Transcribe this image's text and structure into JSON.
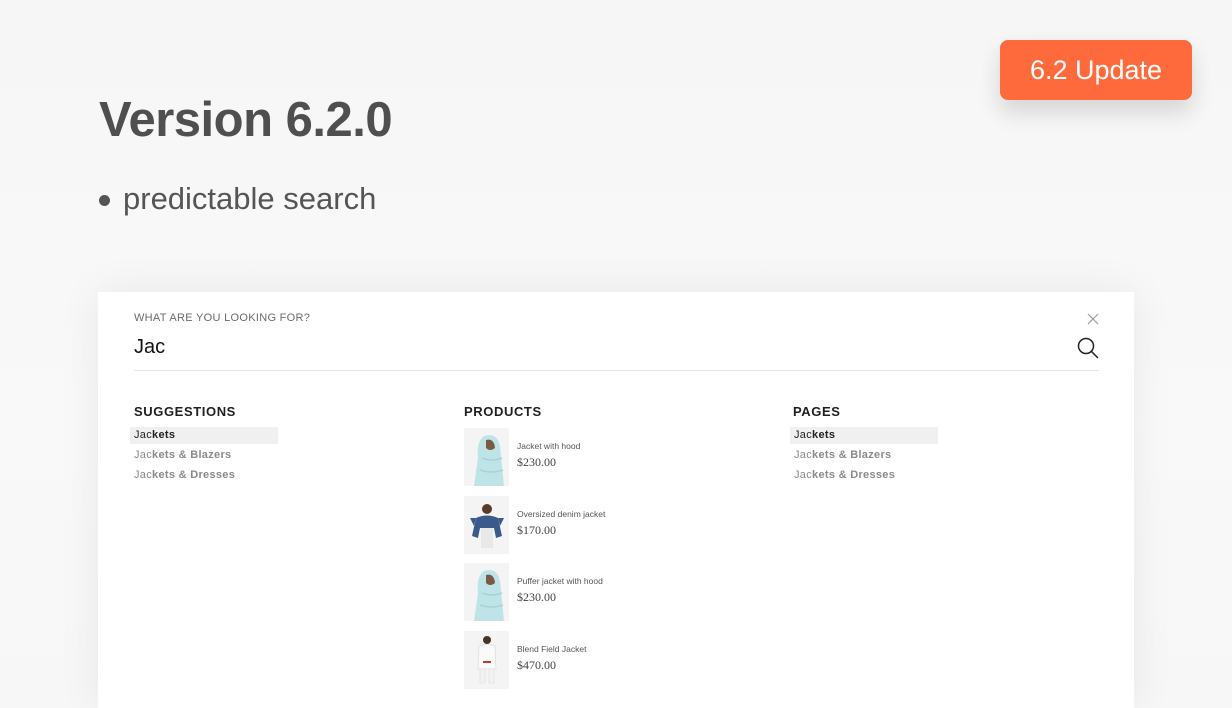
{
  "badge": {
    "label": "6.2 Update"
  },
  "page": {
    "title": "Version 6.2.0",
    "features": [
      "predictable search"
    ]
  },
  "search": {
    "label": "WHAT ARE YOU LOOKING FOR?",
    "value": "Jac",
    "close_icon": "close-icon",
    "search_icon": "search-icon"
  },
  "suggestions": {
    "heading": "SUGGESTIONS",
    "items": [
      {
        "match": "Jac",
        "rest": "kets"
      },
      {
        "match": "Jac",
        "rest": "kets & Blazers"
      },
      {
        "match": "Jac",
        "rest": "kets & Dresses"
      }
    ]
  },
  "products": {
    "heading": "PRODUCTS",
    "items": [
      {
        "name": "Jacket with hood",
        "price": "$230.00"
      },
      {
        "name": "Oversized denim jacket",
        "price": "$170.00"
      },
      {
        "name": "Puffer jacket with hood",
        "price": "$230.00"
      },
      {
        "name": "Blend Field Jacket",
        "price": "$470.00"
      }
    ]
  },
  "pages": {
    "heading": "PAGES",
    "items": [
      {
        "match": "Jac",
        "rest": "kets"
      },
      {
        "match": "Jac",
        "rest": "kets & Blazers"
      },
      {
        "match": "Jac",
        "rest": "kets & Dresses"
      }
    ]
  },
  "colors": {
    "badge": "#ff6a3d",
    "puffer": "#bfe4e8",
    "denim": "#3b5a8c"
  }
}
